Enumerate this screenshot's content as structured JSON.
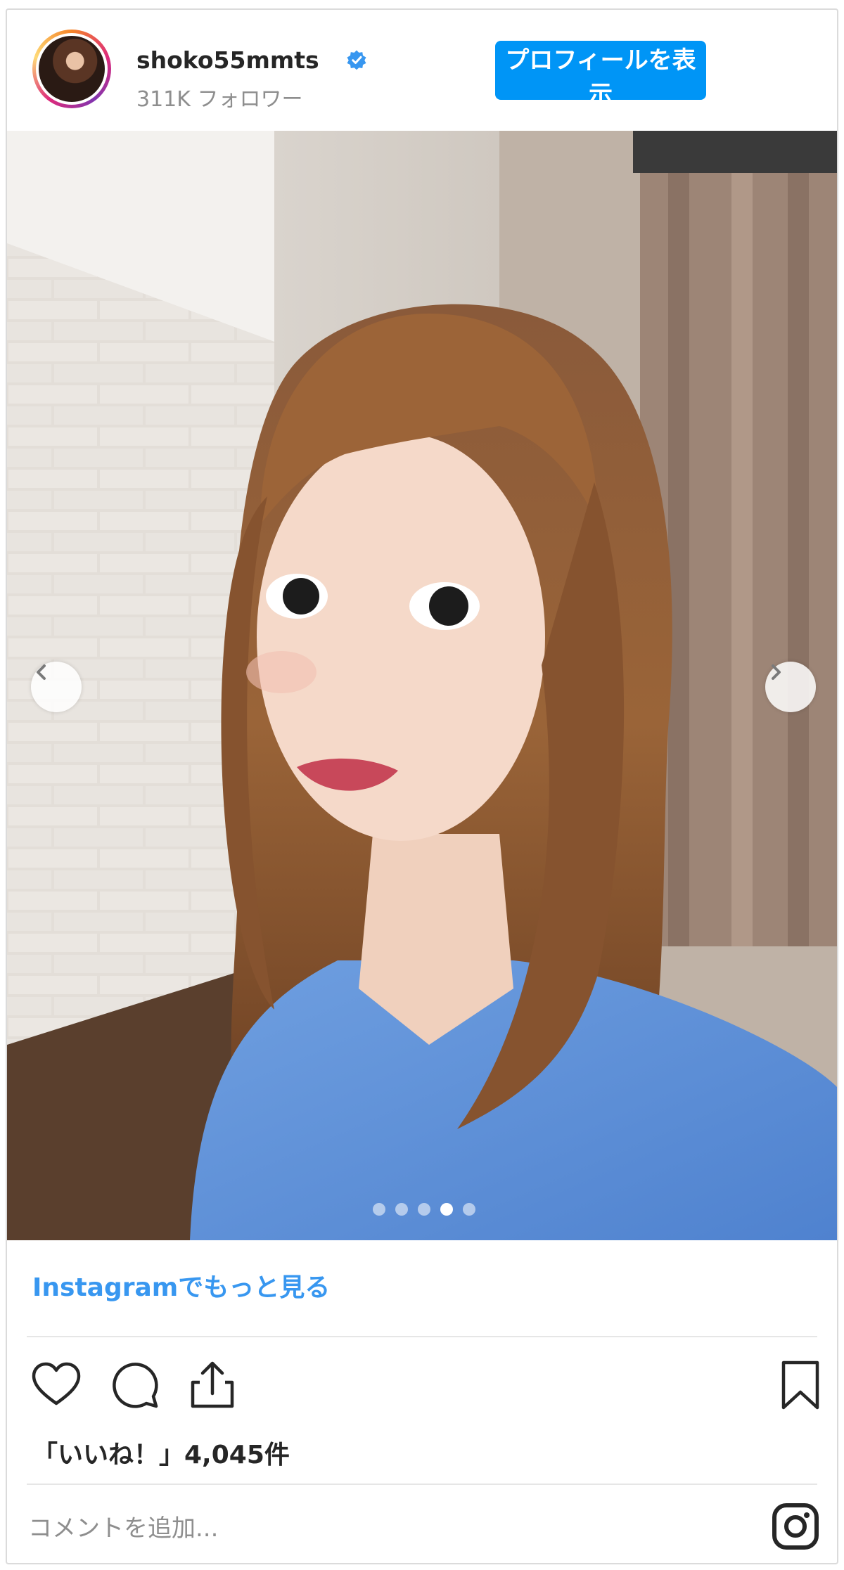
{
  "header": {
    "username": "shoko55mmts",
    "followers": "311K フォロワー",
    "profile_button": "プロフィールを表示"
  },
  "post": {
    "slide_count": 5,
    "active_slide": 4
  },
  "footer": {
    "more_link": "Instagramでもっと見る",
    "likes_text": "「いいね！」4,045件",
    "comment_placeholder": "コメントを追加..."
  },
  "colors": {
    "accent": "#0095f6",
    "link": "#3897f0",
    "text": "#262626",
    "muted": "#8e8e8e"
  },
  "icons": [
    "heart-icon",
    "comment-icon",
    "share-icon",
    "bookmark-icon",
    "instagram-icon",
    "verified-icon",
    "chevron-left-icon",
    "chevron-right-icon"
  ]
}
